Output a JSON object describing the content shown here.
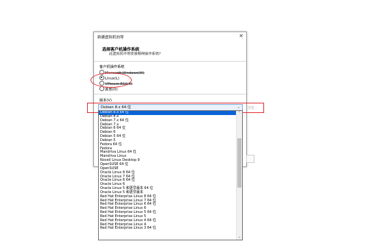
{
  "window": {
    "title": "新建虚拟机向导"
  },
  "header": {
    "title": "选择客户机操作系统",
    "subtitle": "此虚拟机中将安装哪种操作系统?"
  },
  "os_group": {
    "label": "客户机操作系统",
    "options": [
      {
        "label": "Microsoft Windows(W)",
        "selected": false
      },
      {
        "label": "Linux(L)",
        "selected": true
      },
      {
        "label": "VMware ESX(X)",
        "selected": false
      },
      {
        "label": "其他(O)",
        "selected": false
      }
    ]
  },
  "version": {
    "label": "版本(V)",
    "selected": "Debian 8.x 64 位"
  },
  "side_label": "浏览...",
  "version_list": [
    "Debian 8.x 64 位",
    "Debian 8.x",
    "Debian 7.x 64 位",
    "Debian 7.x",
    "Debian 6 64 位",
    "Debian 6",
    "Debian 5 64 位",
    "Debian 5",
    "Fedora 64 位",
    "Fedora",
    "Mandriva Linux 64 位",
    "Mandriva Linux",
    "Novell Linux Desktop 9",
    "OpenSUSE 64 位",
    "OpenSUSE",
    "Oracle Linux 8 64 位",
    "Oracle Linux 7 64 位",
    "Oracle Linux 6 64 位",
    "Oracle Linux 6",
    "Oracle Linux 5 和更早版本 64 位",
    "Oracle Linux 5 和更早版本",
    "Red Hat Enterprise Linux 8 64 位",
    "Red Hat Enterprise Linux 7 64 位",
    "Red Hat Enterprise Linux 6 64 位",
    "Red Hat Enterprise Linux 6",
    "Red Hat Enterprise Linux 5 64 位",
    "Red Hat Enterprise Linux 5",
    "Red Hat Enterprise Linux 4 64 位",
    "Red Hat Enterprise Linux 4",
    "Red Hat Enterprise Linux 3 64 位"
  ],
  "colors": {
    "annotation": "#e0262a",
    "selection": "#0a64d8"
  }
}
